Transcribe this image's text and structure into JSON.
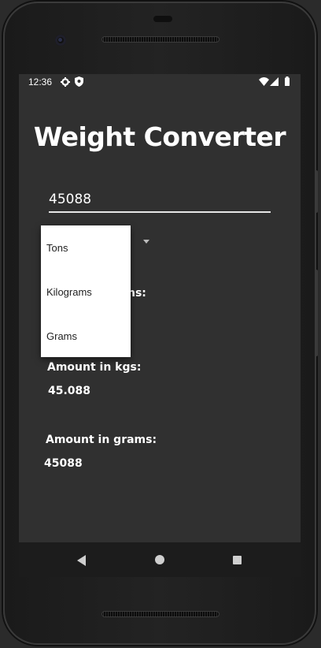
{
  "status_bar": {
    "time": "12:36",
    "icons": [
      "gear-icon",
      "shield-icon",
      "wifi-icon",
      "signal-icon",
      "battery-icon"
    ]
  },
  "app": {
    "title": "Weight Converter",
    "input_value": "45088",
    "dropdown_options": [
      "Tons",
      "Kilograms",
      "Grams"
    ],
    "tons_label_partial": "ns:",
    "kgs_label": "Amount in kgs:",
    "kgs_value": "45.088",
    "grams_label": "Amount in grams:",
    "grams_value": "45088"
  },
  "nav_bar": {
    "buttons": [
      "back-icon",
      "home-icon",
      "recents-icon"
    ]
  },
  "colors": {
    "screen_bg": "#303030",
    "text": "#ffffff",
    "dropdown_bg": "#ffffff",
    "navbar_bg": "#1c1c1c"
  }
}
